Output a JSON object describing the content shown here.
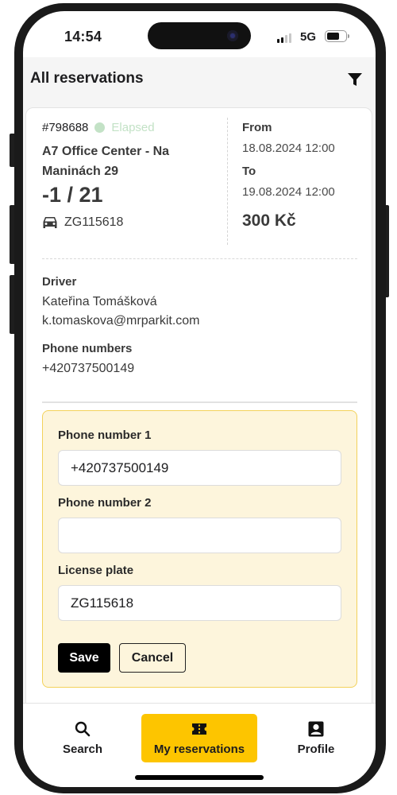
{
  "status_bar": {
    "time": "14:54",
    "network": "5G",
    "signal_bars_active": 2,
    "signal_bars_total": 4,
    "battery_level_percent": 70
  },
  "header": {
    "title": "All reservations",
    "filter_icon": "filter-icon"
  },
  "reservation": {
    "id": "#798688",
    "status": "Elapsed",
    "status_color": "#c3e2c6",
    "location": "A7 Office Center - Na Maninách 29",
    "spot": "-1 / 21",
    "vehicle_icon": "car-icon",
    "license_plate": "ZG115618",
    "from_label": "From",
    "from_value": "18.08.2024 12:00",
    "to_label": "To",
    "to_value": "19.08.2024 12:00",
    "price": "300 Kč"
  },
  "driver": {
    "label": "Driver",
    "name": "Kateřina Tomášková",
    "email": "k.tomaskova@mrparkit.com",
    "phones_label": "Phone numbers",
    "phone": "+420737500149"
  },
  "edit_form": {
    "phone1_label": "Phone number 1",
    "phone1_value": "+420737500149",
    "phone2_label": "Phone number 2",
    "phone2_value": "",
    "plate_label": "License plate",
    "plate_value": "ZG115618",
    "save_label": "Save",
    "cancel_label": "Cancel",
    "panel_bg": "#fdf5dc",
    "panel_border": "#f3d25b"
  },
  "bottom_nav": {
    "accent": "#fdc500",
    "items": [
      {
        "label": "Search",
        "icon": "search-icon",
        "active": false
      },
      {
        "label": "My reservations",
        "icon": "ticket-icon",
        "active": true
      },
      {
        "label": "Profile",
        "icon": "profile-icon",
        "active": false
      }
    ]
  }
}
